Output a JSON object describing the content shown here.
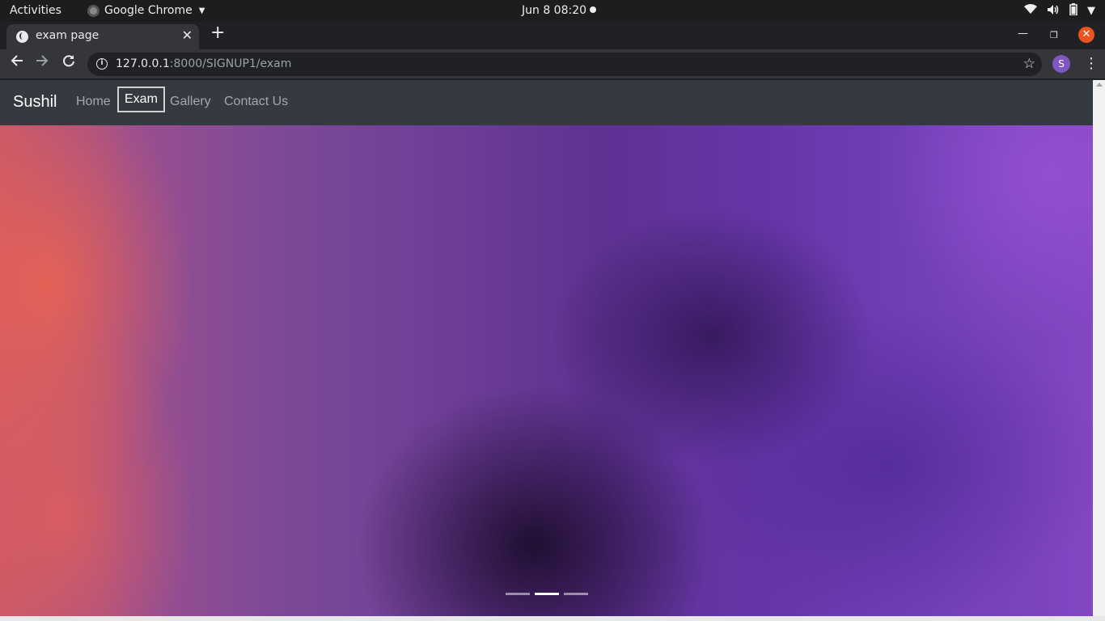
{
  "os_bar": {
    "activities": "Activities",
    "app_name": "Google Chrome",
    "clock": "Jun 8  08:20"
  },
  "browser": {
    "tab_title": "exam page",
    "url_host": "127.0.0.1",
    "url_path": ":8000/SIGNUP1/exam",
    "profile_initial": "S"
  },
  "navbar": {
    "brand": "Sushil",
    "links": [
      "Home",
      "Exam",
      "Gallery",
      "Contact Us"
    ],
    "active_link": "Exam"
  },
  "carousel": {
    "indicator_count": 3,
    "active_indicator": 2
  },
  "colors": {
    "navbar_bg": "#343a40",
    "accent_close": "#e95420",
    "avatar": "#7e57c2"
  }
}
